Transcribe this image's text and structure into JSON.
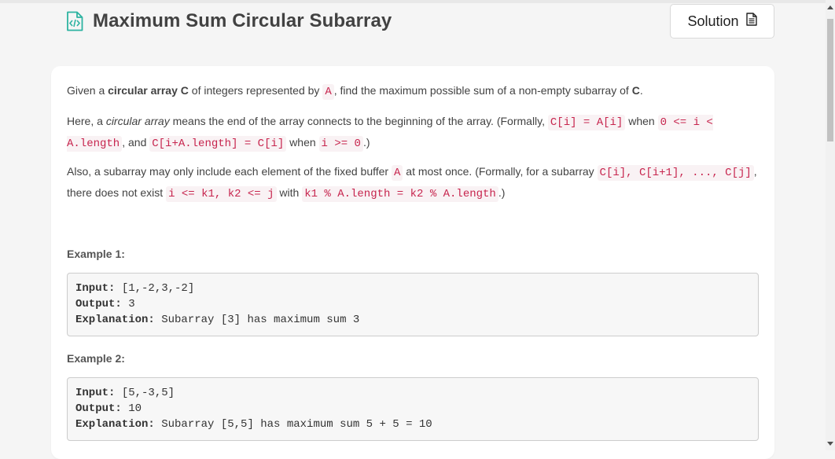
{
  "problem": {
    "title": "Maximum Sum Circular Subarray",
    "solution_label": "Solution",
    "description": [
      [
        {
          "t": "text",
          "v": "Given a "
        },
        {
          "t": "bold",
          "v": "circular array"
        },
        {
          "t": "text",
          "v": " "
        },
        {
          "t": "bold",
          "v": "C"
        },
        {
          "t": "text",
          "v": " of integers represented by "
        },
        {
          "t": "code",
          "v": "A"
        },
        {
          "t": "text",
          "v": ", find the maximum possible sum of a non-empty subarray of "
        },
        {
          "t": "bold",
          "v": "C"
        },
        {
          "t": "text",
          "v": "."
        }
      ],
      [
        {
          "t": "text",
          "v": "Here, a "
        },
        {
          "t": "italic",
          "v": "circular array"
        },
        {
          "t": "text",
          "v": " means the end of the array connects to the beginning of the array.  (Formally, "
        },
        {
          "t": "code",
          "v": "C[i] = A[i]"
        },
        {
          "t": "text",
          "v": " when "
        },
        {
          "t": "code",
          "v": "0 <= i < A.length"
        },
        {
          "t": "text",
          "v": ", and "
        },
        {
          "t": "code",
          "v": "C[i+A.length] = C[i]"
        },
        {
          "t": "text",
          "v": " when "
        },
        {
          "t": "code",
          "v": "i >= 0"
        },
        {
          "t": "text",
          "v": ".)"
        }
      ],
      [
        {
          "t": "text",
          "v": "Also, a subarray may only include each element of the fixed buffer "
        },
        {
          "t": "code",
          "v": "A"
        },
        {
          "t": "text",
          "v": " at most once.  (Formally, for a subarray "
        },
        {
          "t": "code",
          "v": "C[i], C[i+1], ..., C[j]"
        },
        {
          "t": "text",
          "v": ", there does not exist "
        },
        {
          "t": "code",
          "v": "i <= k1, k2 <= j"
        },
        {
          "t": "text",
          "v": " with "
        },
        {
          "t": "code",
          "v": "k1 % A.length = k2 % A.length"
        },
        {
          "t": "text",
          "v": ".)"
        }
      ]
    ],
    "examples": [
      {
        "label": "Example 1:",
        "input_key": "Input:",
        "input_val": " [1,-2,3,-2]",
        "output_key": "Output:",
        "output_val": " 3",
        "explanation_key": "Explanation:",
        "explanation_val": " Subarray [3] has maximum sum 3"
      },
      {
        "label": "Example 2:",
        "input_key": "Input:",
        "input_val": " [5,-3,5]",
        "output_key": "Output:",
        "output_val": " 10",
        "explanation_key": "Explanation:",
        "explanation_val": " Subarray [5,5] has maximum sum 5 + 5 = 10"
      }
    ]
  },
  "icons": {
    "title_icon": "code-document-icon",
    "solution_icon": "document-icon"
  },
  "colors": {
    "title_icon": "#2db3a1",
    "inline_code": "#c7254e",
    "inline_code_bg": "#f9f2f4"
  }
}
